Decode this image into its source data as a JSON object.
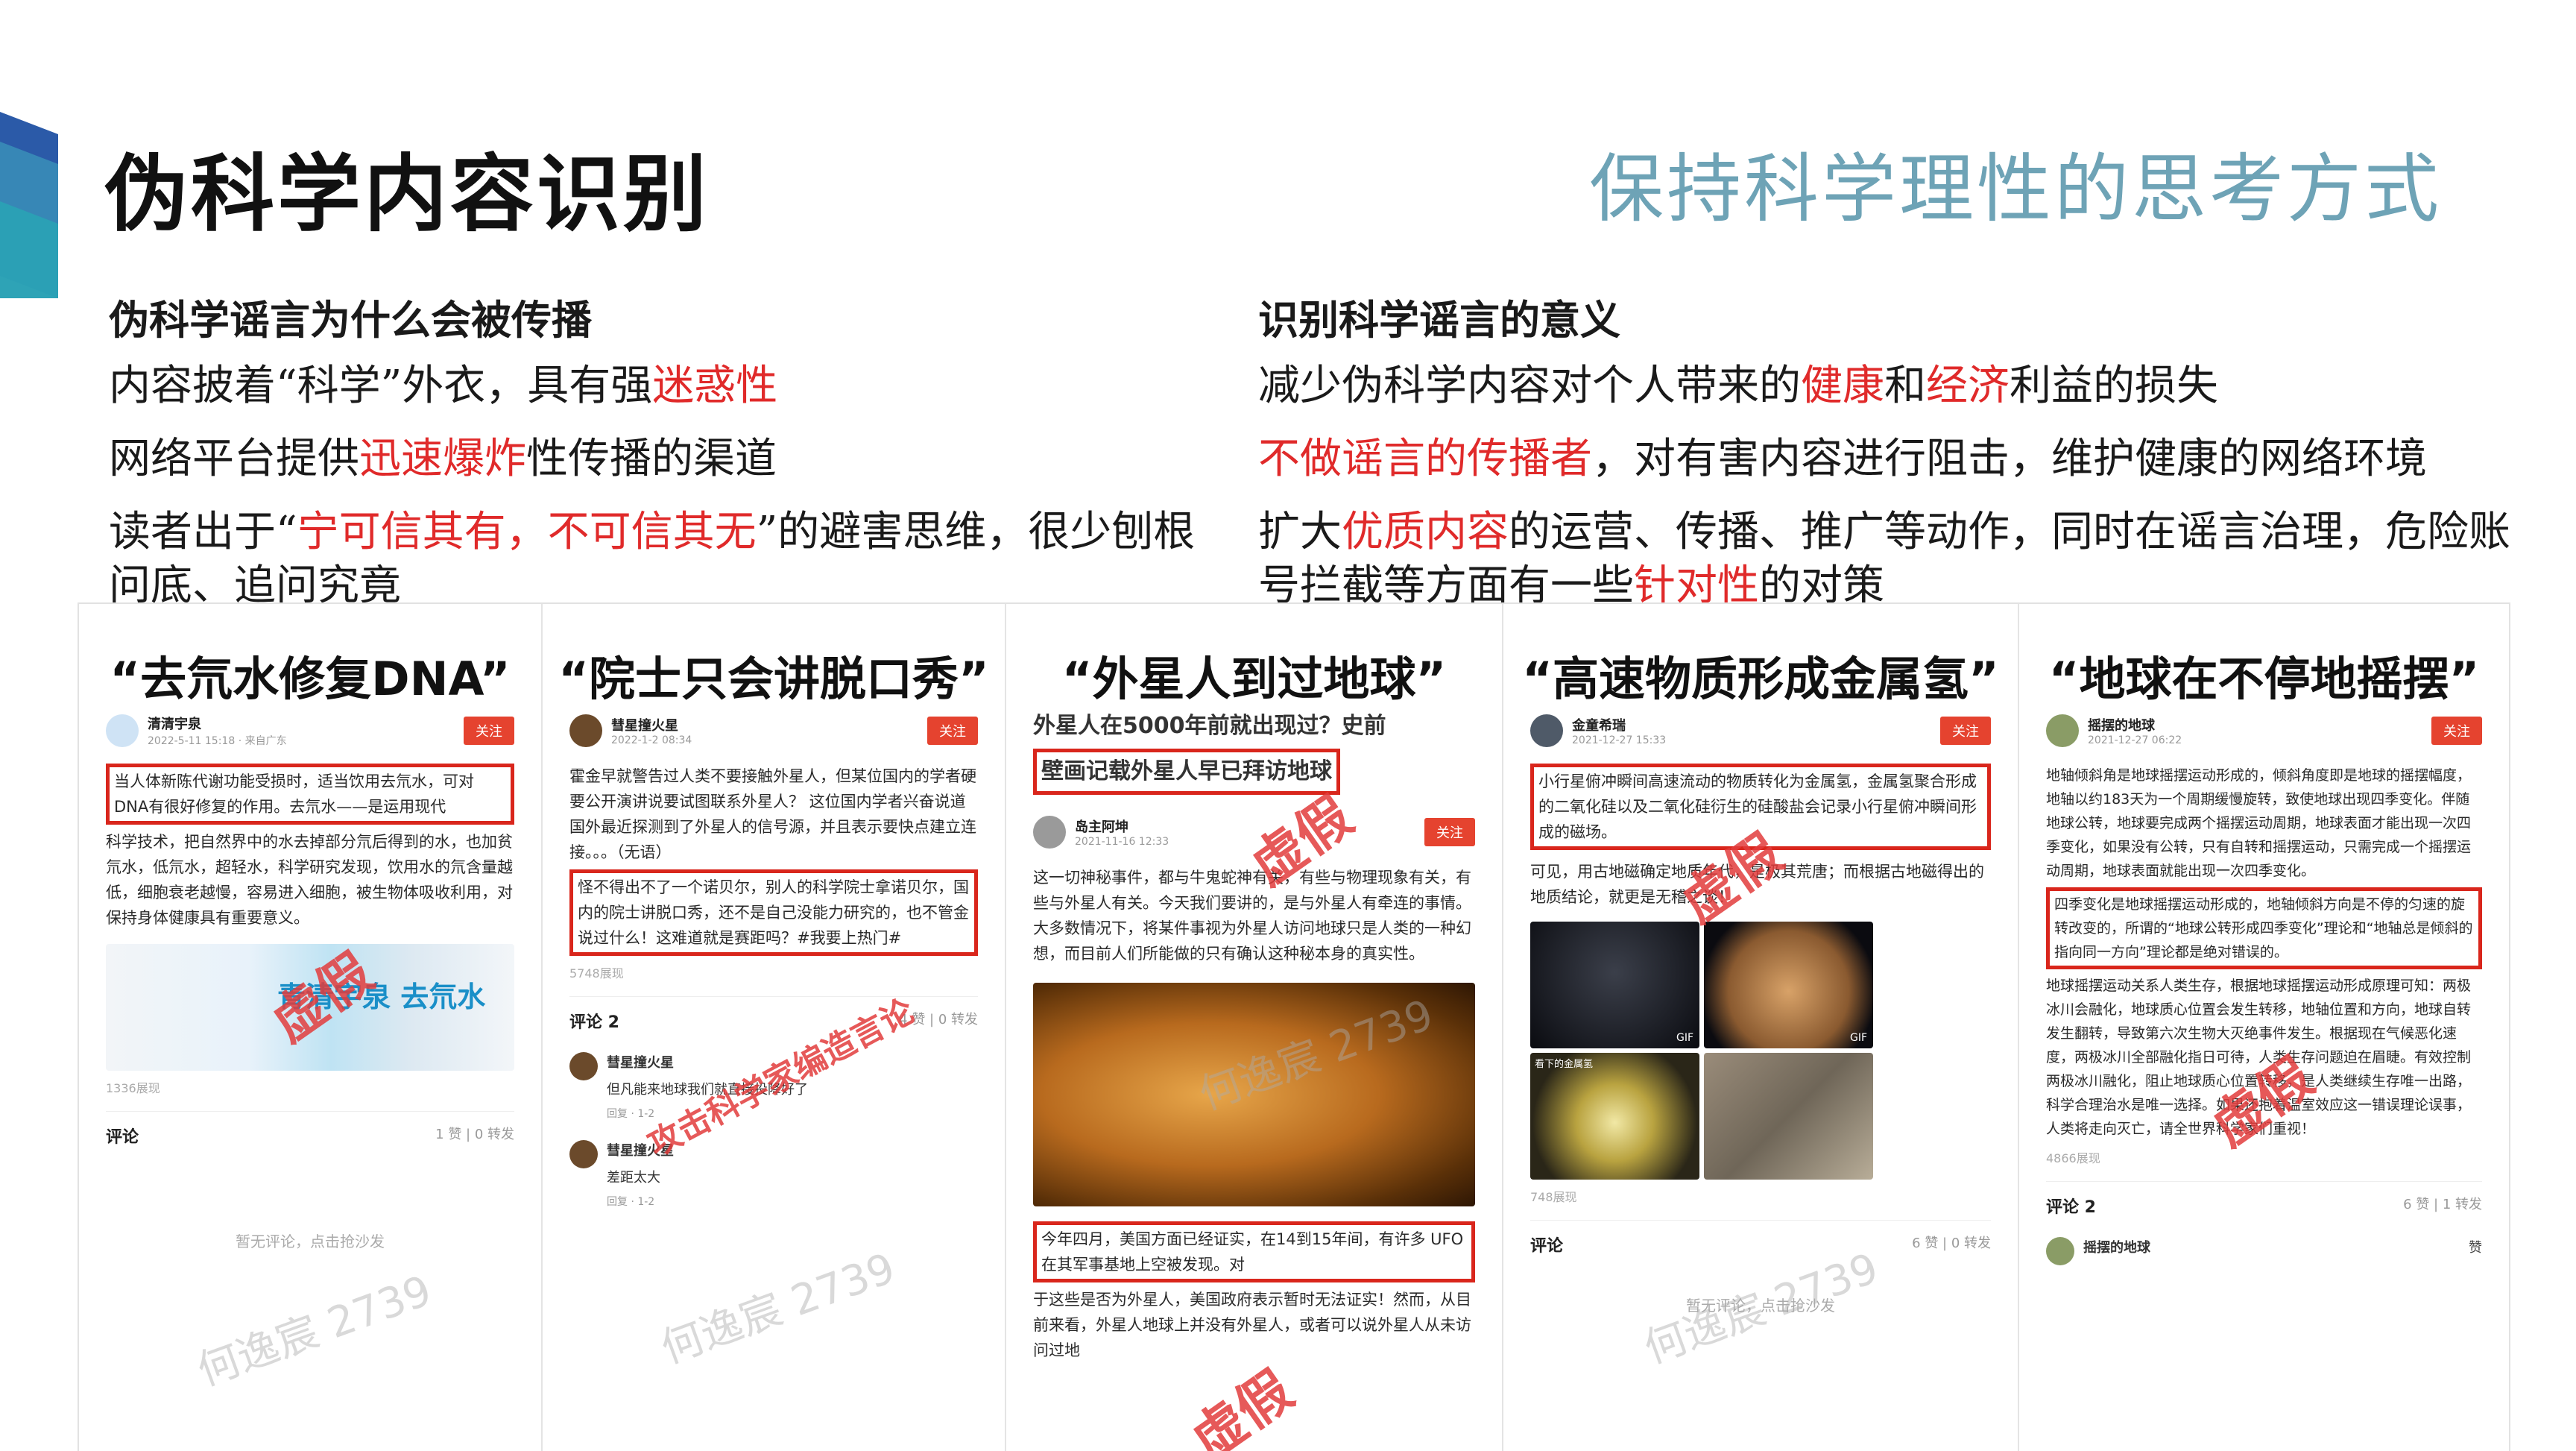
{
  "slide": {
    "title": "伪科学内容识别",
    "subtitle": "保持科学理性的思考方式"
  },
  "left": {
    "heading": "伪科学谣言为什么会被传播",
    "p1a": "内容披着“科学”外衣，具有强",
    "p1b": "迷惑性",
    "p2a": "网络平台提供",
    "p2b": "迅速爆炸",
    "p2c": "性传播的渠道",
    "p3a": "读者出于“",
    "p3b": "宁可信其有，不可信其无",
    "p3c": "”的避害思维，很少刨根问底、追问究竟"
  },
  "right": {
    "heading": "识别科学谣言的意义",
    "p1a": "减少伪科学内容对个人带来的",
    "p1b": "健康",
    "p1c": "和",
    "p1d": "经济",
    "p1e": "利益的损失",
    "p2a": "不做谣言的传播者",
    "p2b": "，对有害内容进行阻击，维护健康的网络环境",
    "p3a": "扩大",
    "p3b": "优质内容",
    "p3c": "的运营、传播、推广等动作，同时在谣言治理，危险账号拦截等方面有一些",
    "p3d": "针对性",
    "p3e": "的对策"
  },
  "watermark": "何逸宸 2739",
  "stamp_fake": "虚假",
  "follow": "关注",
  "panels": [
    {
      "title": "“去氘水修复DNA”",
      "author": "清清宇泉",
      "date": "2022-5-11 15:18 · 来自广东",
      "boxed": "当人体新陈代谢功能受损时，适当饮用去氘水，可对DNA有很好修复的作用。去氘水——是运用现代",
      "text": "科学技术，把自然界中的水去掉部分氘后得到的水，也加贫氘水，低氘水，超轻水，科学研究发现，饮用水的氘含量越低，细胞衰老越慢，容易进入细胞，被生物体吸收利用，对保持身体健康具有重要意义。",
      "image_text": "青清宇泉 去氘水",
      "views": "1336展现",
      "comments_label": "评论",
      "stats": "1 赞 | 0 转发",
      "empty": "暂无评论，点击抢沙发"
    },
    {
      "title": "“院士只会讲脱口秀”",
      "author": "彗星撞火星",
      "date": "2022-1-2 08:34",
      "text": "霍金早就警告过人类不要接触外星人，但某位国内的学者硬要公开演讲说要试图联系外星人？ 这位国内学者兴奋说道国外最近探测到了外星人的信号源，并且表示要快点建立连接。。。（无语）",
      "boxed": "怪不得出不了一个诺贝尔，别人的科学院士拿诺贝尔，国内的院士讲脱口秀，还不是自己没能力研究的，也不管金说过什么！这难道就是赛距吗？#我要上热门#",
      "views": "5748展现",
      "comments_label": "评论 2",
      "stats": "4 赞 | 0 转发",
      "stamp": "攻击科学家编造言论",
      "c1_name": "彗星撞火星",
      "c1_text": "但凡能来地球我们就直接投降好了",
      "c2_name": "彗星撞火星",
      "c2_text": "差距太大",
      "reply": "回复 ·  1-2"
    },
    {
      "title": "“外星人到过地球”",
      "headline_a": "外星人在5000年前就出现过？史前",
      "headline_b": "壁画记载外星人早已拜访地球",
      "author": "岛主阿坤",
      "date": "2021-11-16 12:33",
      "text": "这一切神秘事件，都与牛鬼蛇神有关，有些与物理现象有关，有些与外星人有关。今天我们要讲的，是与外星人有牵连的事情。大多数情况下，将某件事视为外星人访问地球只是人类的一种幻想，而目前人们所能做的只有确认这种秘本身的真实性。",
      "boxed": "今年四月，美国方面已经证实，在14到15年间，有许多 UFO在其军事基地上空被发现。对",
      "after": "于这些是否为外星人，美国政府表示暂时无法证实！然而，从目前来看，外星人地球上并没有外星人，或者可以说外星人从未访问过地"
    },
    {
      "title": "“高速物质形成金属氢”",
      "author": "金童希瑞",
      "date": "2021-12-27 15:33",
      "boxed": "小行星俯冲瞬间高速流动的物质转化为金属氢，金属氢聚合形成的二氧化硅以及二氧化硅衍生的硅酸盐会记录小行星俯冲瞬间形成的磁场。",
      "text": "可见，用古地磁确定地质年代，是极其荒唐；而根据古地磁得出的地质结论，就更是无稽之谈！",
      "gif": "GIF",
      "img_caption": "看下的金属氢",
      "views": "748展现",
      "comments_label": "评论",
      "stats": "6 赞 | 0 转发",
      "empty": "暂无评论，点击抢沙发"
    },
    {
      "title": "“地球在不停地摇摆”",
      "author": "摇摆的地球",
      "date": "2021-12-27 06:22",
      "text1": "地轴倾斜角是地球摇摆运动形成的，倾斜角度即是地球的摇摆幅度，地轴以约183天为一个周期缓慢旋转，致使地球出现四季变化。伴随地球公转，地球要完成两个摇摆运动周期，地球表面才能出现一次四季变化，如果没有公转，只有自转和摇摆运动，只需完成一个摇摆运动周期，地球表面就能出现一次四季变化。",
      "boxed": "四季变化是地球摇摆运动形成的，地轴倾斜方向是不停的匀速的旋转改变的，所谓的“地球公转形成四季变化”理论和“地轴总是倾斜的指向同一方向”理论都是绝对错误的。",
      "text2": "地球摇摆运动关系人类生存，根据地球摇摆运动形成原理可知：两极冰川会融化，地球质心位置会发生转移，地轴位置和方向，地球自转发生翻转，导致第六次生物大灭绝事件发生。根据现在气候恶化速度，两极冰川全部融化指日可待，人类生存问题迫在眉睫。有效控制两极冰川融化，阻止地球质心位置转移，是人类继续生存唯一出路，科学合理治水是唯一选择。如果还抱着温室效应这一错误理论误事，人类将走向灭亡，请全世界科学家们重视！",
      "views": "4866展现",
      "comments_label": "评论 2",
      "stats": "6 赞 | 1 转发",
      "c1_name": "摇摆的地球",
      "like": "赞"
    }
  ]
}
